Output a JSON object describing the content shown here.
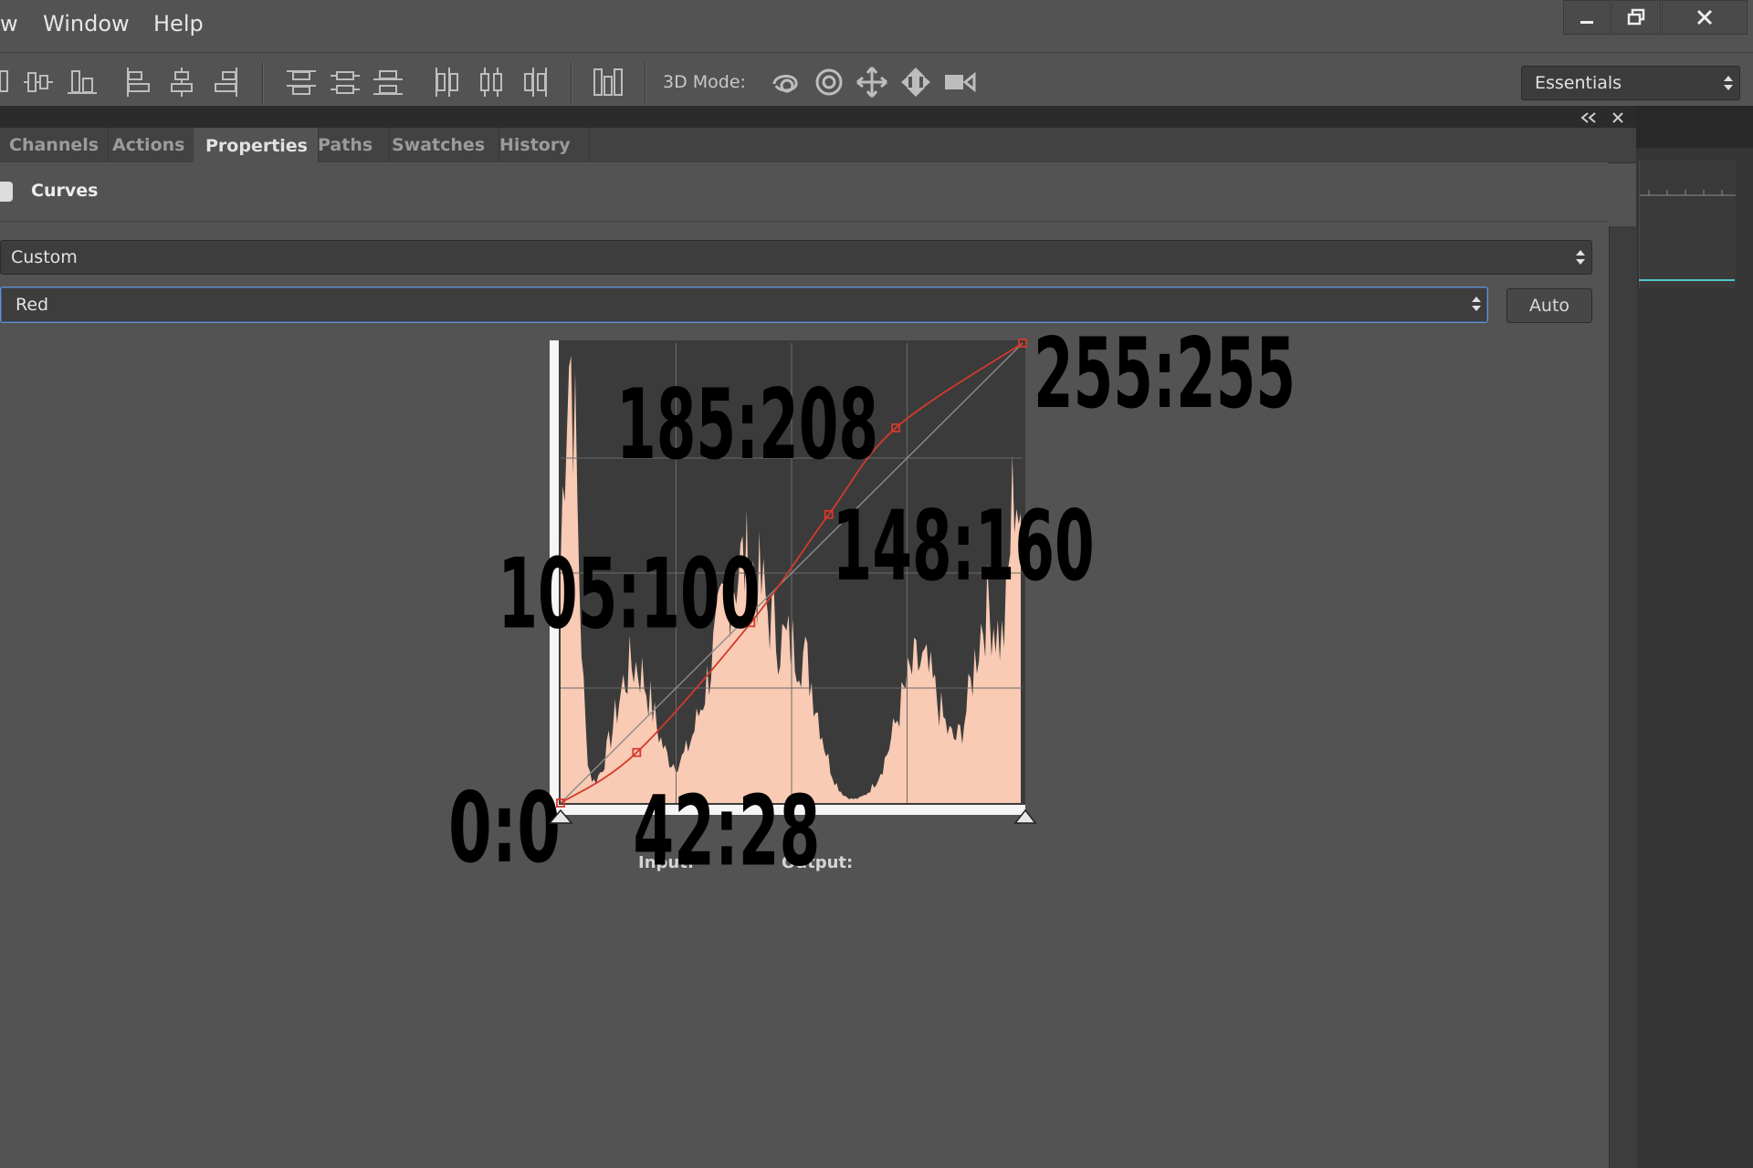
{
  "menu": {
    "items": [
      "w",
      "Window",
      "Help"
    ]
  },
  "toolbar": {
    "mode_label": "3D Mode:"
  },
  "workspace": {
    "selected": "Essentials"
  },
  "panel": {
    "tabs": [
      "Channels",
      "Actions",
      "Properties",
      "Paths",
      "Swatches",
      "History"
    ],
    "active_tab": "Properties"
  },
  "curves": {
    "title": "Curves",
    "preset": "Custom",
    "channel": "Red",
    "auto_label": "Auto",
    "input_label": "Input:",
    "output_label": "Output:",
    "curve_color": "#d33a2c",
    "histogram_color": "#f9cbb4",
    "points": [
      {
        "input": 0,
        "output": 0,
        "label": "0:0"
      },
      {
        "input": 42,
        "output": 28,
        "label": "42:28"
      },
      {
        "input": 105,
        "output": 100,
        "label": "105:100"
      },
      {
        "input": 148,
        "output": 160,
        "label": "148:160"
      },
      {
        "input": 185,
        "output": 208,
        "label": "185:208"
      },
      {
        "input": 255,
        "output": 255,
        "label": "255:255"
      }
    ]
  }
}
